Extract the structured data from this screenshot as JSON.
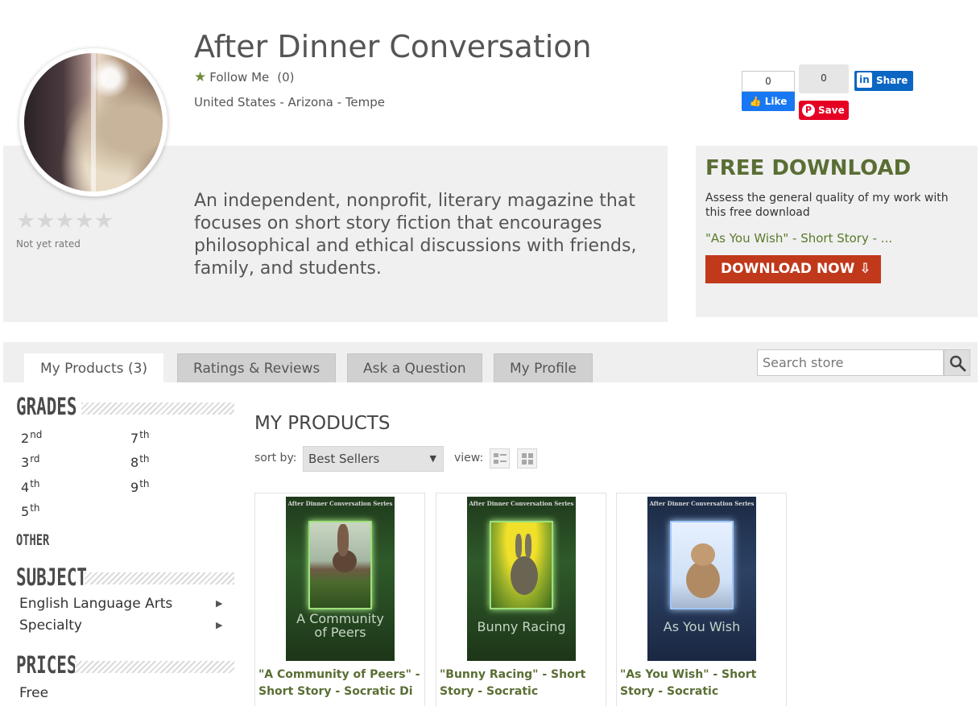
{
  "store": {
    "title": "After Dinner Conversation",
    "follow_label": "Follow Me",
    "follow_count": "(0)",
    "location": "United States - Arizona - Tempe",
    "description": "An independent, nonprofit, literary magazine that focuses on short story fiction that encourages philosophical and ethical discussions with friends, family, and students.",
    "rating_text": "Not yet rated"
  },
  "social": {
    "facebook_count": "0",
    "facebook_label": "Like",
    "pinterest_count": "0",
    "pinterest_label": "Save",
    "linkedin_label": "Share",
    "linkedin_mark": "in"
  },
  "free_download": {
    "heading": "FREE DOWNLOAD",
    "text": "Assess the general quality of my work with this free download",
    "link": "\"As You Wish\" - Short Story - ...",
    "button": "DOWNLOAD NOW"
  },
  "tabs": [
    {
      "label": "My Products (3)",
      "active": true
    },
    {
      "label": "Ratings & Reviews",
      "active": false
    },
    {
      "label": "Ask a Question",
      "active": false
    },
    {
      "label": "My Profile",
      "active": false
    }
  ],
  "search": {
    "placeholder": "Search store"
  },
  "sidebar": {
    "grades_heading": "GRADES",
    "grades": [
      {
        "num": "2",
        "suffix": "nd"
      },
      {
        "num": "7",
        "suffix": "th"
      },
      {
        "num": "3",
        "suffix": "rd"
      },
      {
        "num": "8",
        "suffix": "th"
      },
      {
        "num": "4",
        "suffix": "th"
      },
      {
        "num": "9",
        "suffix": "th"
      },
      {
        "num": "5",
        "suffix": "th"
      }
    ],
    "other_heading": "OTHER",
    "subject_heading": "SUBJECT",
    "subjects": [
      "English Language Arts",
      "Specialty"
    ],
    "prices_heading": "PRICES",
    "prices": [
      "Free"
    ]
  },
  "products_section": {
    "heading": "MY PRODUCTS",
    "sort_label": "sort by:",
    "sort_value": "Best Sellers",
    "view_label": "view:"
  },
  "products": [
    {
      "cover_series": "After Dinner Conversation Series",
      "cover_title_1": "A Community",
      "cover_title_2": "of Peers",
      "title": "\"A Community of Peers\" - Short Story - Socratic Di"
    },
    {
      "cover_series": "After Dinner Conversation Series",
      "cover_title_1": "Bunny Racing",
      "cover_title_2": "",
      "title": "\"Bunny Racing\" - Short Story - Socratic"
    },
    {
      "cover_series": "After Dinner Conversation Series",
      "cover_title_1": "As You Wish",
      "cover_title_2": "",
      "title": "\"As You Wish\" - Short Story - Socratic"
    }
  ],
  "colors": {
    "accent_green": "#5a6e34",
    "download_red": "#c0391b",
    "facebook_blue": "#1877f2",
    "pinterest_red": "#e60023",
    "linkedin_blue": "#0a66c2"
  }
}
